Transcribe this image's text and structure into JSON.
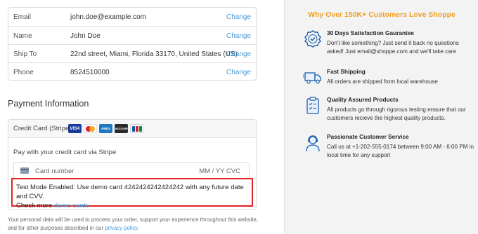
{
  "review": {
    "rows": [
      {
        "label": "Email",
        "value": "john.doe@example.com",
        "action": "Change"
      },
      {
        "label": "Name",
        "value": "John Doe",
        "action": "Change"
      },
      {
        "label": "Ship To",
        "value": "22nd street, Miami, Florida 33170, United States (US)",
        "action": "Change"
      },
      {
        "label": "Phone",
        "value": "8524510000",
        "action": "Change"
      }
    ]
  },
  "payment": {
    "title": "Payment Information",
    "method_label": "Credit Card (Stripe)",
    "card_logos": [
      "VISA",
      "mastercard",
      "AMEX",
      "DISCOVER",
      "JCB"
    ],
    "instruction": "Pay with your credit card via Stripe",
    "card_number_placeholder": "Card number",
    "expiry_cvc_placeholder": "MM / YY  CVC",
    "test_mode_text": "Test Mode Enabled: Use demo card 4242424242424242 with any future date and CVV.",
    "check_more_text": "Check more ",
    "demo_cards_link": "demo cards"
  },
  "privacy": {
    "text": "Your personal data will be used to process your order, support your experience throughout this website, and for other purposes described in our ",
    "link": "privacy policy",
    "suffix": "."
  },
  "trust": {
    "title": "Why Over 150K+ Customers Love Shoppe",
    "accent_color": "#f0a027",
    "features": [
      {
        "icon": "badge-check-icon",
        "heading": "30 Days Satisfaction Gaurantee",
        "text": "Don't like something? Just send it back no questions asked! Just email@shoppe.com and we'll take care"
      },
      {
        "icon": "delivery-truck-icon",
        "heading": "Fast Shipping",
        "text": "All orders are shipped from local warehouse"
      },
      {
        "icon": "clipboard-check-icon",
        "heading": "Quality Assured Products",
        "text": "All products go through rigorous testing ensure that our customers recieve the highest quality products."
      },
      {
        "icon": "support-agent-icon",
        "heading": "Passionate Customer Service",
        "text": "Call us at +1-202-555-0174 between 9:00 AM - 6:00 PM in local time for any support"
      }
    ]
  }
}
